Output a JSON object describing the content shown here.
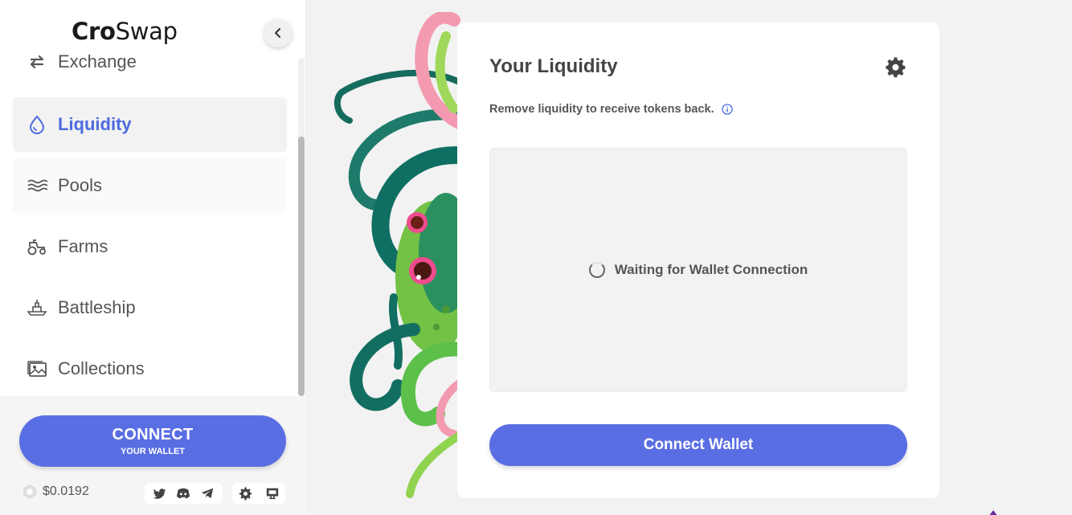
{
  "sidebar": {
    "logo_bold": "Cro",
    "logo_light": "Swap",
    "nav": [
      {
        "label": "Exchange",
        "icon": "exchange-icon"
      },
      {
        "label": "Liquidity",
        "icon": "drop-icon"
      },
      {
        "label": "Pools",
        "icon": "waves-icon"
      },
      {
        "label": "Farms",
        "icon": "tractor-icon"
      },
      {
        "label": "Battleship",
        "icon": "ship-icon"
      },
      {
        "label": "Collections",
        "icon": "gallery-icon"
      }
    ],
    "active_item": "Liquidity",
    "connect_main": "CONNECT",
    "connect_sub": "YOUR WALLET",
    "price": "$0.0192"
  },
  "card": {
    "title": "Your Liquidity",
    "subtitle": "Remove liquidity to receive tokens back.",
    "waiting": "Waiting for Wallet Connection",
    "button": "Connect Wallet"
  },
  "colors": {
    "accent": "#5a6ee3",
    "active_nav": "#4d6be0",
    "background": "#f2f2f2"
  }
}
